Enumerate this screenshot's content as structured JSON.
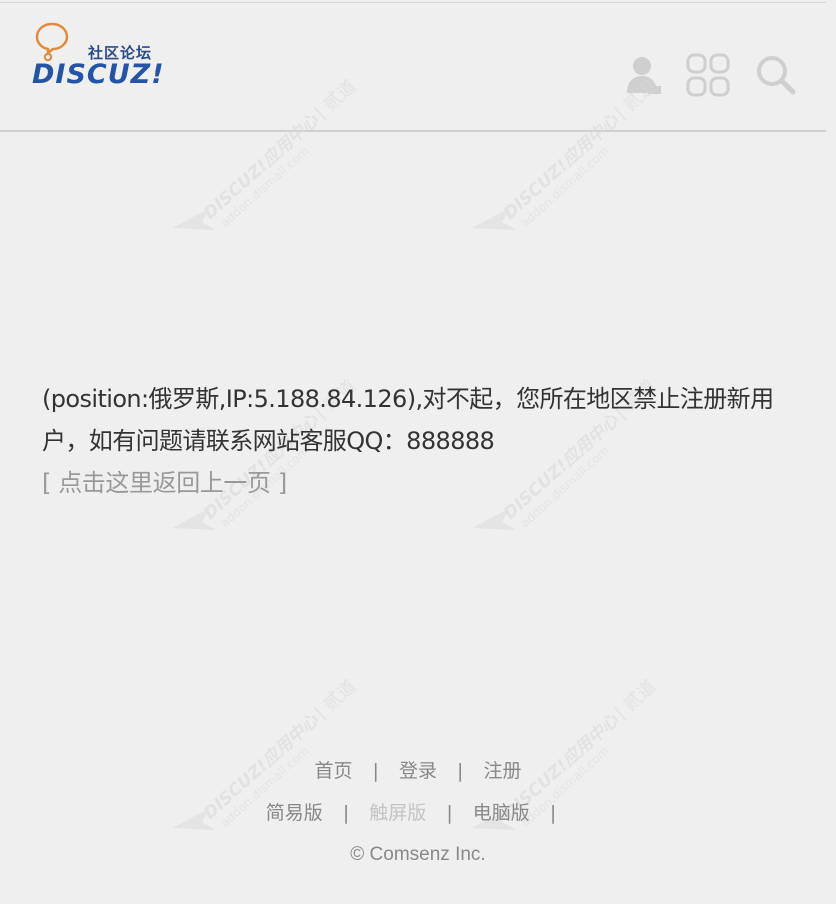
{
  "header": {
    "logo_cn": "社区论坛",
    "logo_word": "DISCUZ!",
    "icons": [
      "user-icon",
      "apps-grid-icon",
      "search-icon"
    ]
  },
  "message": {
    "text": "(position:俄罗斯,IP:5.188.84.126),对不起，您所在地区禁止注册新用户，如有问题请联系网站客服QQ：888888",
    "back_link": "[ 点击这里返回上一页 ]"
  },
  "footer": {
    "row1": [
      "首页",
      "登录",
      "注册"
    ],
    "row2": [
      "简易版",
      "触屏版",
      "电脑版"
    ],
    "separator": "|",
    "copyright": "© Comsenz Inc."
  },
  "watermark": {
    "text_main": "DISCUZ!应用中心",
    "text_url": "addon.dismall.com",
    "text_tag": "贰道"
  },
  "colors": {
    "background": "#efefef",
    "text": "#333333",
    "muted": "#888888",
    "logo_blue": "#2454a8",
    "logo_orange": "#e28a3a"
  }
}
